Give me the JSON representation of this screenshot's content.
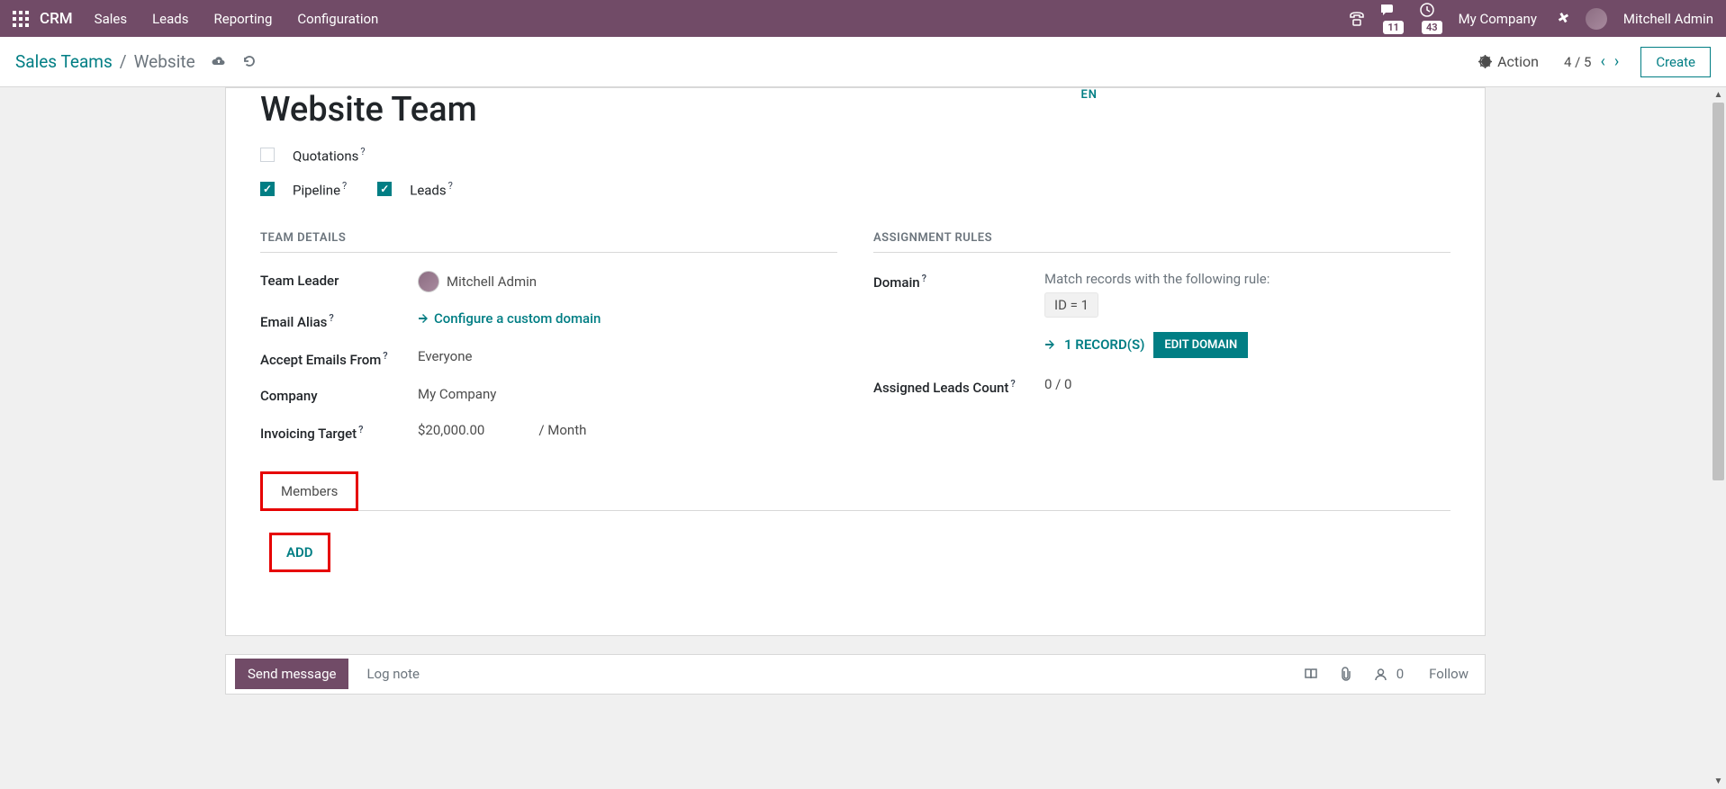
{
  "navbar": {
    "brand": "CRM",
    "menu": [
      "Sales",
      "Leads",
      "Reporting",
      "Configuration"
    ],
    "msg_count": "11",
    "clock_count": "43",
    "company": "My Company",
    "user": "Mitchell Admin"
  },
  "controlbar": {
    "breadcrumb_root": "Sales Teams",
    "breadcrumb_current": "Website",
    "action_label": "Action",
    "pager": "4 / 5",
    "create": "Create"
  },
  "sheet": {
    "lang_badge": "EN",
    "title": "Website Team",
    "options": {
      "quotations": {
        "label": "Quotations",
        "checked": false
      },
      "pipeline": {
        "label": "Pipeline",
        "checked": true
      },
      "leads": {
        "label": "Leads",
        "checked": true
      }
    },
    "team_details_title": "TEAM DETAILS",
    "fields": {
      "team_leader_label": "Team Leader",
      "team_leader_value": "Mitchell Admin",
      "email_alias_label": "Email Alias",
      "email_alias_link": "Configure a custom domain",
      "accept_label": "Accept Emails From",
      "accept_value": "Everyone",
      "company_label": "Company",
      "company_value": "My Company",
      "invoicing_label": "Invoicing Target",
      "invoicing_value": "$20,000.00",
      "invoicing_unit": "/ Month"
    },
    "assignment_title": "ASSIGNMENT RULES",
    "domain": {
      "label": "Domain",
      "desc": "Match records with the following rule:",
      "chip": "ID  =  1",
      "records": "1 RECORD(S)",
      "edit": "EDIT DOMAIN"
    },
    "assigned": {
      "label": "Assigned Leads Count",
      "value": "0 / 0"
    },
    "tab_members": "Members",
    "add_btn": "ADD"
  },
  "chatter": {
    "send": "Send message",
    "log": "Log note",
    "followers": "0",
    "follow": "Follow"
  }
}
